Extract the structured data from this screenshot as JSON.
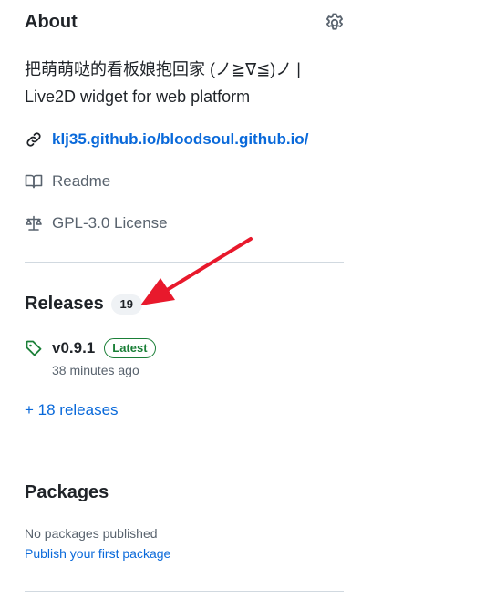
{
  "about": {
    "heading": "About",
    "description": "把萌萌哒的看板娘抱回家 (ノ≧∇≦)ノ | Live2D widget for web platform",
    "website": "klj35.github.io/bloodsoul.github.io/",
    "readme": "Readme",
    "license": "GPL-3.0 License"
  },
  "releases": {
    "heading": "Releases",
    "count": "19",
    "latest_tag": "v0.9.1",
    "latest_badge": "Latest",
    "latest_time": "38 minutes ago",
    "more_link": "+ 18 releases"
  },
  "packages": {
    "heading": "Packages",
    "empty_text": "No packages published",
    "publish_link": "Publish your first package"
  },
  "colors": {
    "link": "#0969da",
    "green": "#1a7f37",
    "arrow": "#e8192c",
    "divider": "#d1d9e0"
  },
  "icons": [
    "gear-icon",
    "link-icon",
    "book-icon",
    "scale-icon",
    "tag-icon",
    "red-arrow"
  ]
}
